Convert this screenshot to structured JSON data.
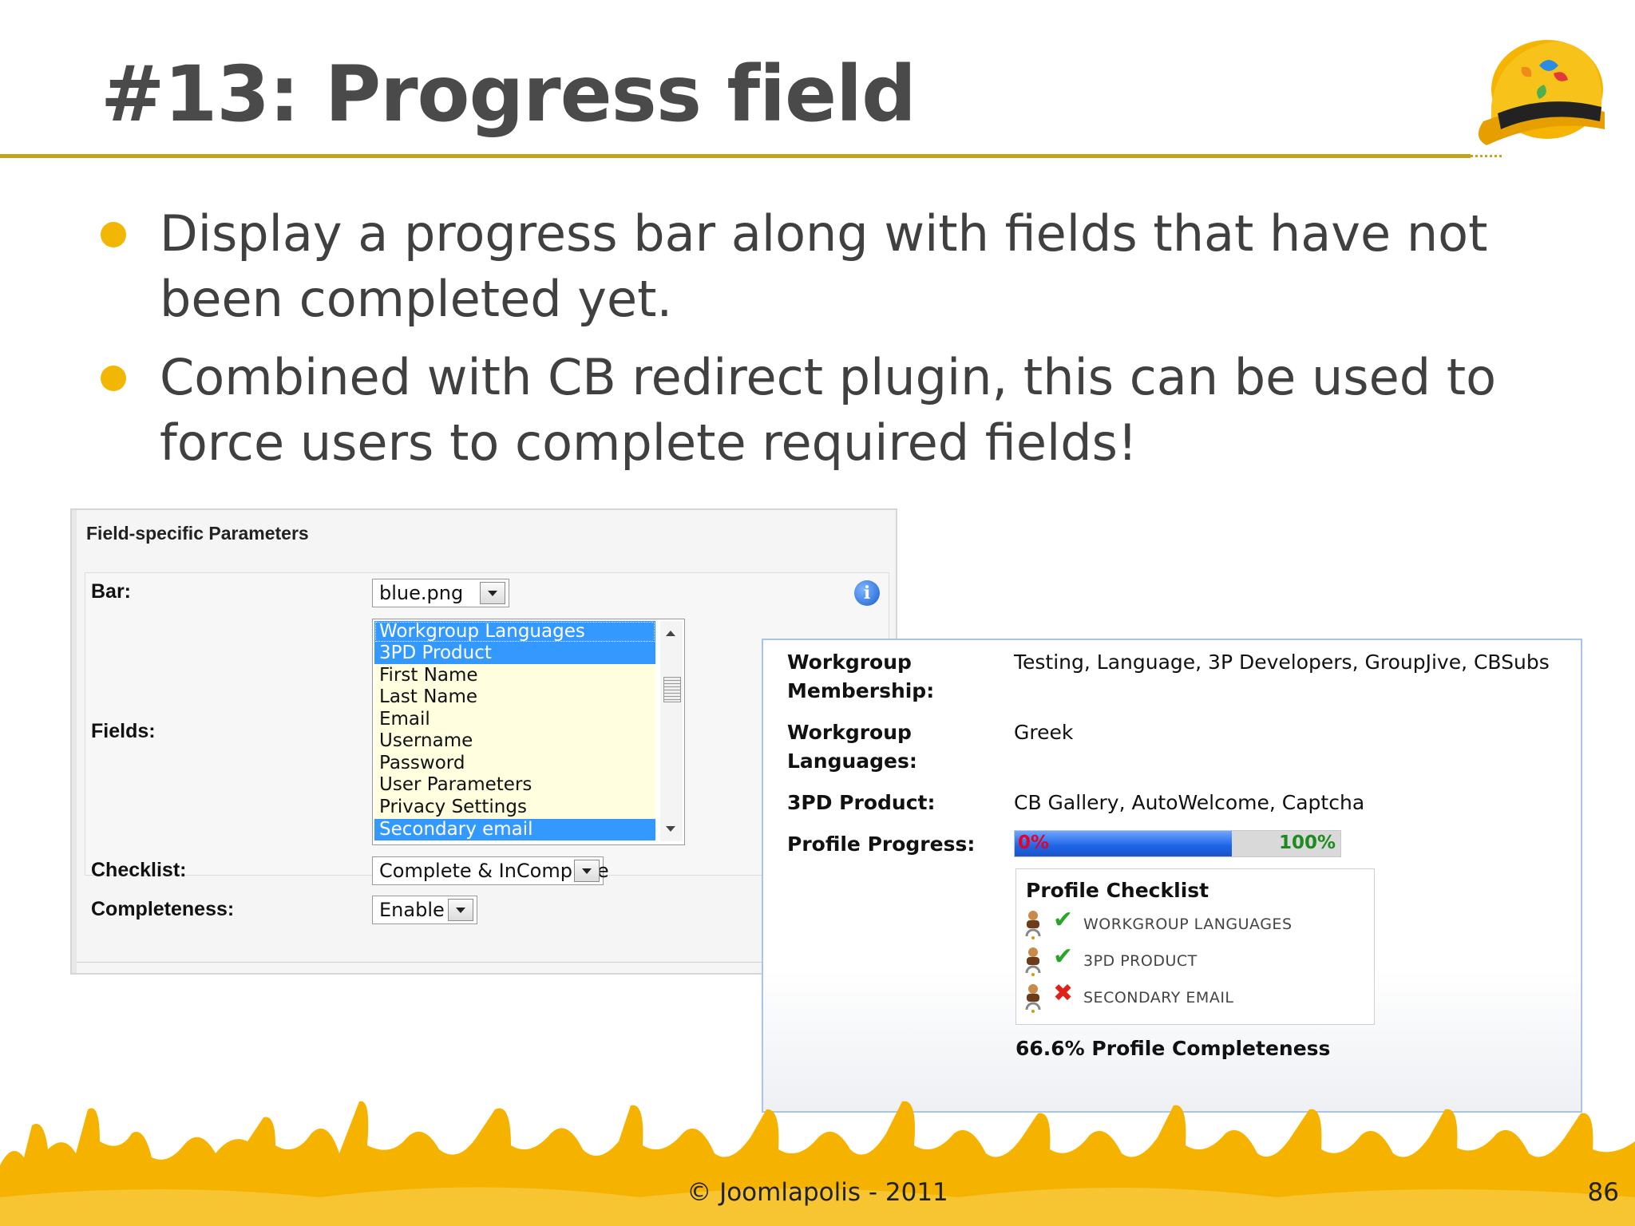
{
  "slide": {
    "title": "#13: Progress field",
    "bullets": [
      "Display a progress bar along with fields that have not been completed yet.",
      "Combined with CB redirect plugin, this can be used to force users to complete required fields!"
    ],
    "footer": "© Joomlapolis - 2011",
    "page_number": "86"
  },
  "params_panel": {
    "heading": "Field-specific Parameters",
    "bar_label": "Bar:",
    "bar_value": "blue.png",
    "fields_label": "Fields:",
    "field_options": [
      {
        "label": "Workgroup Languages",
        "selected": true
      },
      {
        "label": "3PD Product",
        "selected": true
      },
      {
        "label": "First Name",
        "selected": false
      },
      {
        "label": "Last Name",
        "selected": false
      },
      {
        "label": "Email",
        "selected": false
      },
      {
        "label": "Username",
        "selected": false
      },
      {
        "label": "Password",
        "selected": false
      },
      {
        "label": "User Parameters",
        "selected": false
      },
      {
        "label": "Privacy Settings",
        "selected": false
      },
      {
        "label": "Secondary email",
        "selected": true
      }
    ],
    "checklist_label": "Checklist:",
    "checklist_value": "Complete & InComplete",
    "completeness_label": "Completeness:",
    "completeness_value": "Enable",
    "info_icon": "info-icon"
  },
  "profile_panel": {
    "rows": [
      {
        "label": "Workgroup Membership:",
        "value": "Testing, Language, 3P Developers, GroupJive, CBSubs"
      },
      {
        "label": "Workgroup Languages:",
        "value": "Greek"
      },
      {
        "label": "3PD Product:",
        "value": "CB Gallery, AutoWelcome, Captcha"
      }
    ],
    "progress_label": "Profile Progress:",
    "progress_min_label": "0%",
    "progress_max_label": "100%",
    "progress_fraction": 0.666,
    "checklist_title": "Profile Checklist",
    "checklist_items": [
      {
        "label": "WORKGROUP LANGUAGES",
        "complete": true,
        "icon": "check-icon"
      },
      {
        "label": "3PD PRODUCT",
        "complete": true,
        "icon": "check-icon"
      },
      {
        "label": "SECONDARY EMAIL",
        "complete": false,
        "icon": "cross-icon"
      }
    ],
    "completeness_text": "66.6% Profile Completeness"
  },
  "colors": {
    "accent_yellow": "#f2b705",
    "title_rule": "#c8a21a",
    "selection_blue": "#3399ff",
    "progress_blue": "#1c64e6"
  }
}
